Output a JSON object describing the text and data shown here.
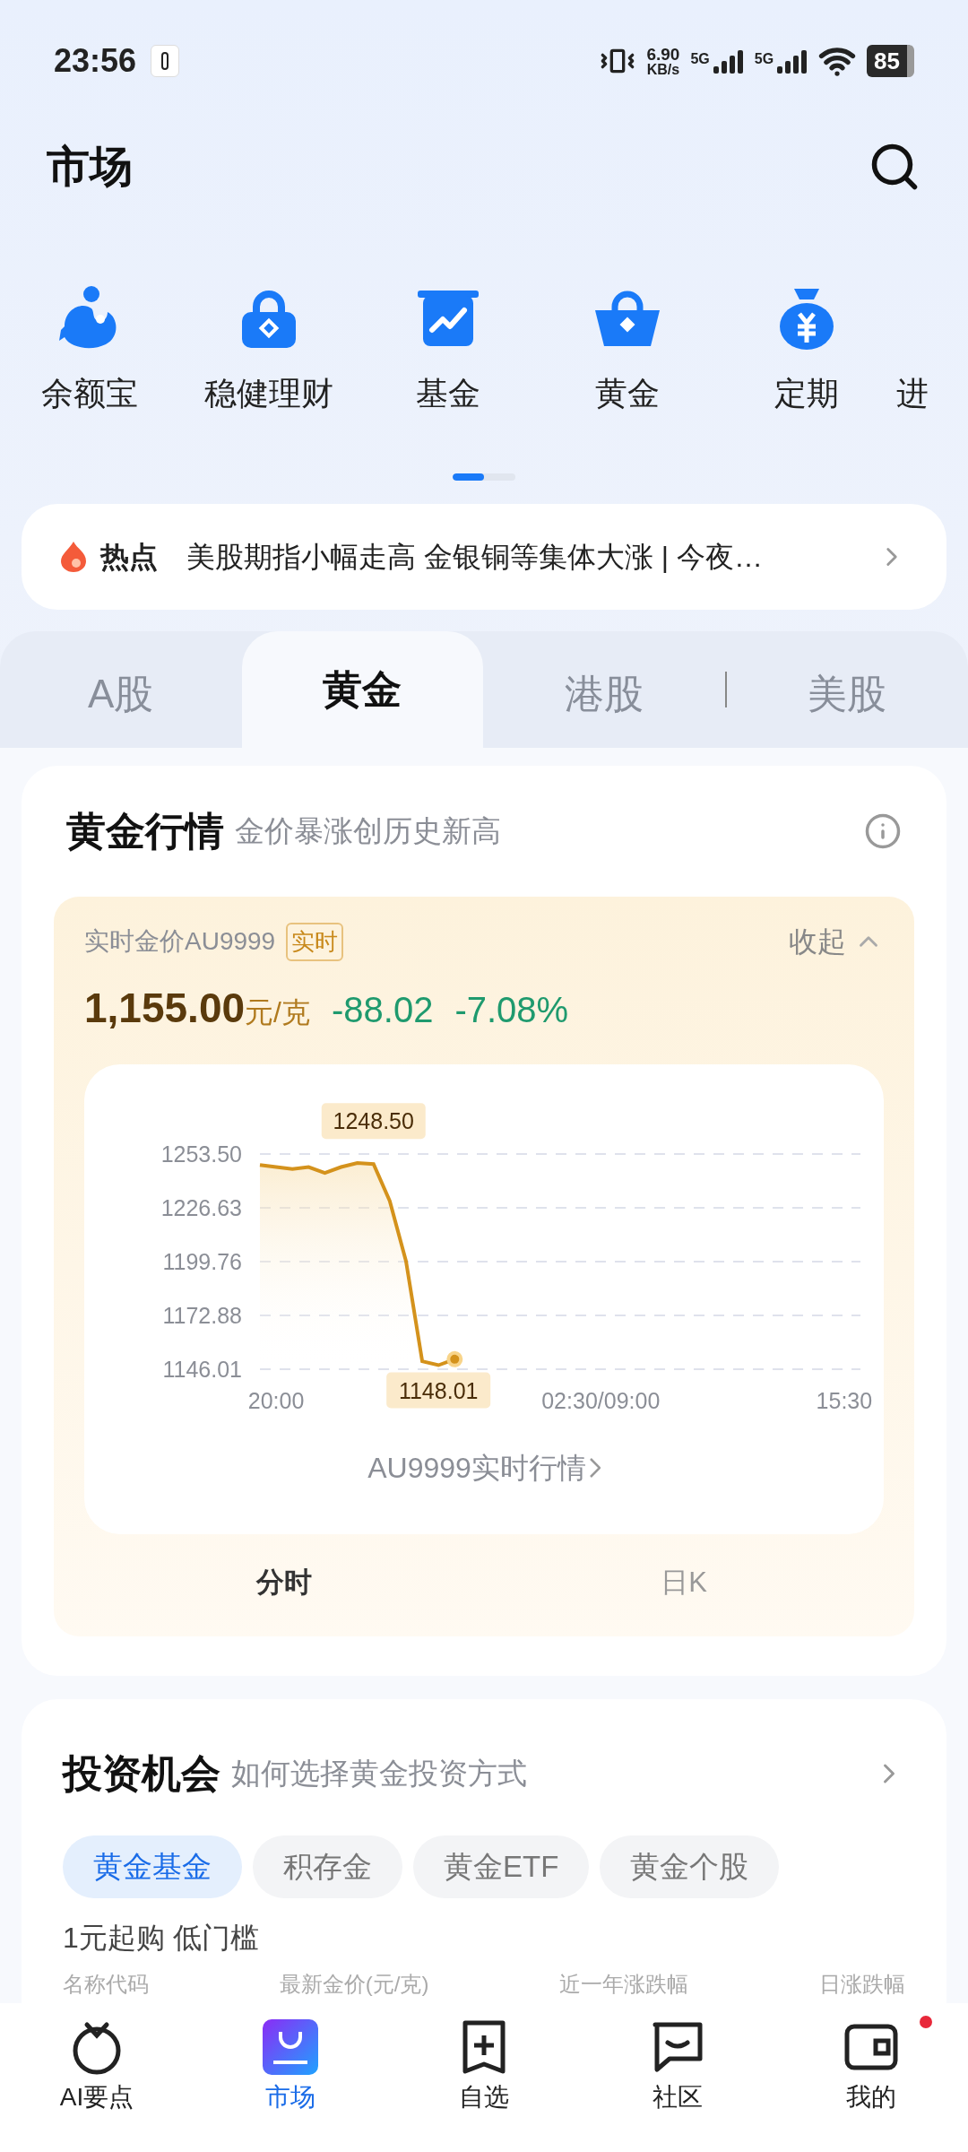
{
  "status_bar": {
    "time": "23:56",
    "speed_value": "6.90",
    "speed_unit": "KB/s",
    "signals": [
      "5G",
      "5G"
    ],
    "battery": "85"
  },
  "header": {
    "title": "市场"
  },
  "shortcuts": [
    {
      "label": "余额宝"
    },
    {
      "label": "稳健理财"
    },
    {
      "label": "基金"
    },
    {
      "label": "黄金"
    },
    {
      "label": "定期"
    },
    {
      "label": "进"
    }
  ],
  "pager": {
    "level": 0.5
  },
  "hot_news": {
    "tag": "热点",
    "text": "美股期指小幅走高 金银铜等集体大涨 | 今夜…"
  },
  "market_tabs": [
    {
      "label": "A股",
      "selected": false
    },
    {
      "label": "黄金",
      "selected": true
    },
    {
      "label": "港股",
      "selected": false
    },
    {
      "label": "美股",
      "selected": false
    }
  ],
  "gold_card": {
    "title": "黄金行情",
    "subtitle": "金价暴涨创历史新高",
    "quote": {
      "name": "实时金价AU9999",
      "badge": "实时",
      "collapse": "收起",
      "price": "1,155.00",
      "unit": "元/克",
      "change": "-88.02",
      "change_pct": "-7.08%"
    },
    "chart_data": {
      "type": "line",
      "categories": [
        null,
        "20:00",
        null,
        null,
        null,
        null,
        null,
        null,
        null,
        null,
        null,
        null,
        null,
        null,
        null,
        null,
        null,
        null,
        null,
        null,
        null,
        "02:30/09:00",
        null,
        null,
        null,
        null,
        null,
        null,
        null,
        null,
        null,
        null,
        null,
        null,
        null,
        null,
        "15:30",
        null
      ],
      "grid": true,
      "series": [
        {
          "color": "#d4921c",
          "values": [
            1248,
            1247,
            1246,
            1247,
            1244,
            1247,
            1249,
            1248.5,
            1230,
            1200,
            1150,
            1148.01,
            1151,
            null,
            null,
            null,
            null,
            null,
            null,
            null,
            null,
            null,
            null,
            null,
            null,
            null,
            null,
            null,
            null,
            null,
            null,
            null,
            null,
            null,
            null,
            null,
            null,
            null
          ]
        }
      ],
      "ylim": [
        1146.01,
        1253.5
      ],
      "yticks": [
        {
          "value": 1253.5,
          "label": "1253.50"
        },
        {
          "value": 1226.63,
          "label": "1226.63"
        },
        {
          "value": 1199.76,
          "label": "1199.76"
        },
        {
          "value": 1172.88,
          "label": "1172.88"
        },
        {
          "value": 1146.01,
          "label": "1146.01"
        }
      ],
      "annotations": [
        {
          "y": 1248.5,
          "text": "1248.50"
        },
        {
          "y": 1148.01,
          "text": "1148.01"
        }
      ]
    },
    "detail_link": "AU9999实时行情",
    "chart_tabs": [
      {
        "label": "分时",
        "selected": true
      },
      {
        "label": "日K",
        "selected": false
      }
    ]
  },
  "invest_card": {
    "title": "投资机会",
    "subtitle": "如何选择黄金投资方式",
    "chips": [
      {
        "label": "黄金基金",
        "selected": true
      },
      {
        "label": "积存金",
        "selected": false
      },
      {
        "label": "黄金ETF",
        "selected": false
      },
      {
        "label": "黄金个股",
        "selected": false
      }
    ],
    "tagline": "1元起购 低门槛",
    "columns": [
      "名称代码",
      "最新金价(元/克)",
      "近一年涨跌幅",
      "日涨跌幅"
    ]
  },
  "bottom_nav": [
    {
      "label": "AI要点",
      "selected": false,
      "dot": false
    },
    {
      "label": "市场",
      "selected": true,
      "dot": false
    },
    {
      "label": "自选",
      "selected": false,
      "dot": false
    },
    {
      "label": "社区",
      "selected": false,
      "dot": false
    },
    {
      "label": "我的",
      "selected": false,
      "dot": true
    }
  ]
}
